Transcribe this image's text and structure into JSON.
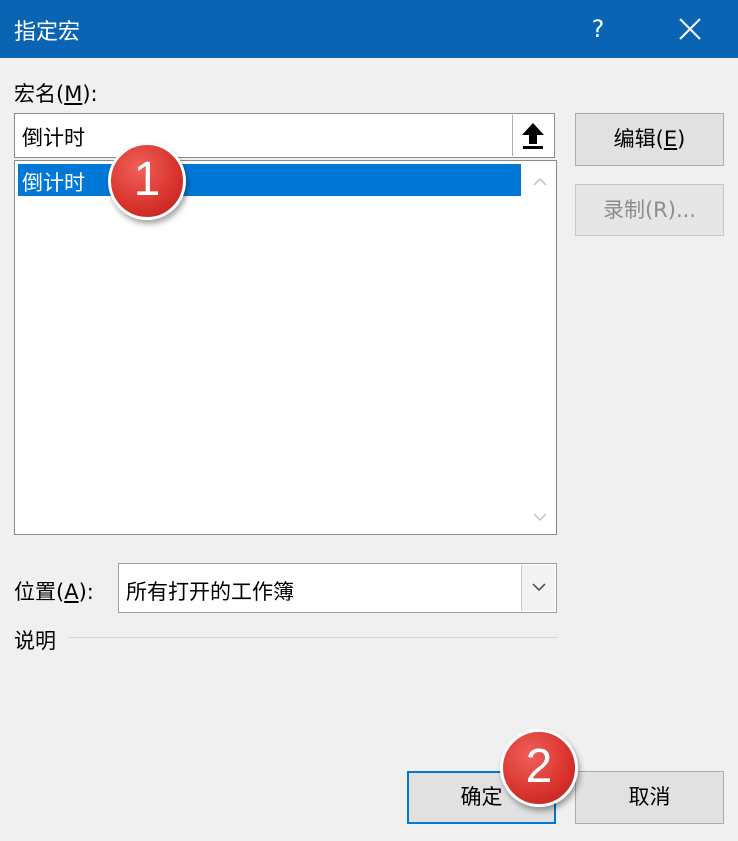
{
  "window": {
    "title": "指定宏",
    "help_label": "?",
    "accent_color": "#0a64b4"
  },
  "macro_name": {
    "label_prefix": "宏名(",
    "label_accel": "M",
    "label_suffix": "):",
    "value": "倒计时"
  },
  "macro_list": {
    "items": [
      {
        "label": "倒计时",
        "selected": true
      }
    ]
  },
  "buttons": {
    "edit": {
      "prefix": "编辑(",
      "accel": "E",
      "suffix": ")"
    },
    "record": {
      "label": "录制(R)...",
      "enabled": false
    },
    "ok": {
      "label": "确定"
    },
    "cancel": {
      "label": "取消"
    }
  },
  "location": {
    "label_prefix": "位置(",
    "label_accel": "A",
    "label_suffix": "):",
    "value": "所有打开的工作簿"
  },
  "description": {
    "label": "说明"
  },
  "annotations": [
    {
      "number": "1"
    },
    {
      "number": "2"
    }
  ],
  "icons": {
    "collapse": "up-arrow-icon",
    "close": "close-icon",
    "dropdown": "chevron-down-icon"
  }
}
